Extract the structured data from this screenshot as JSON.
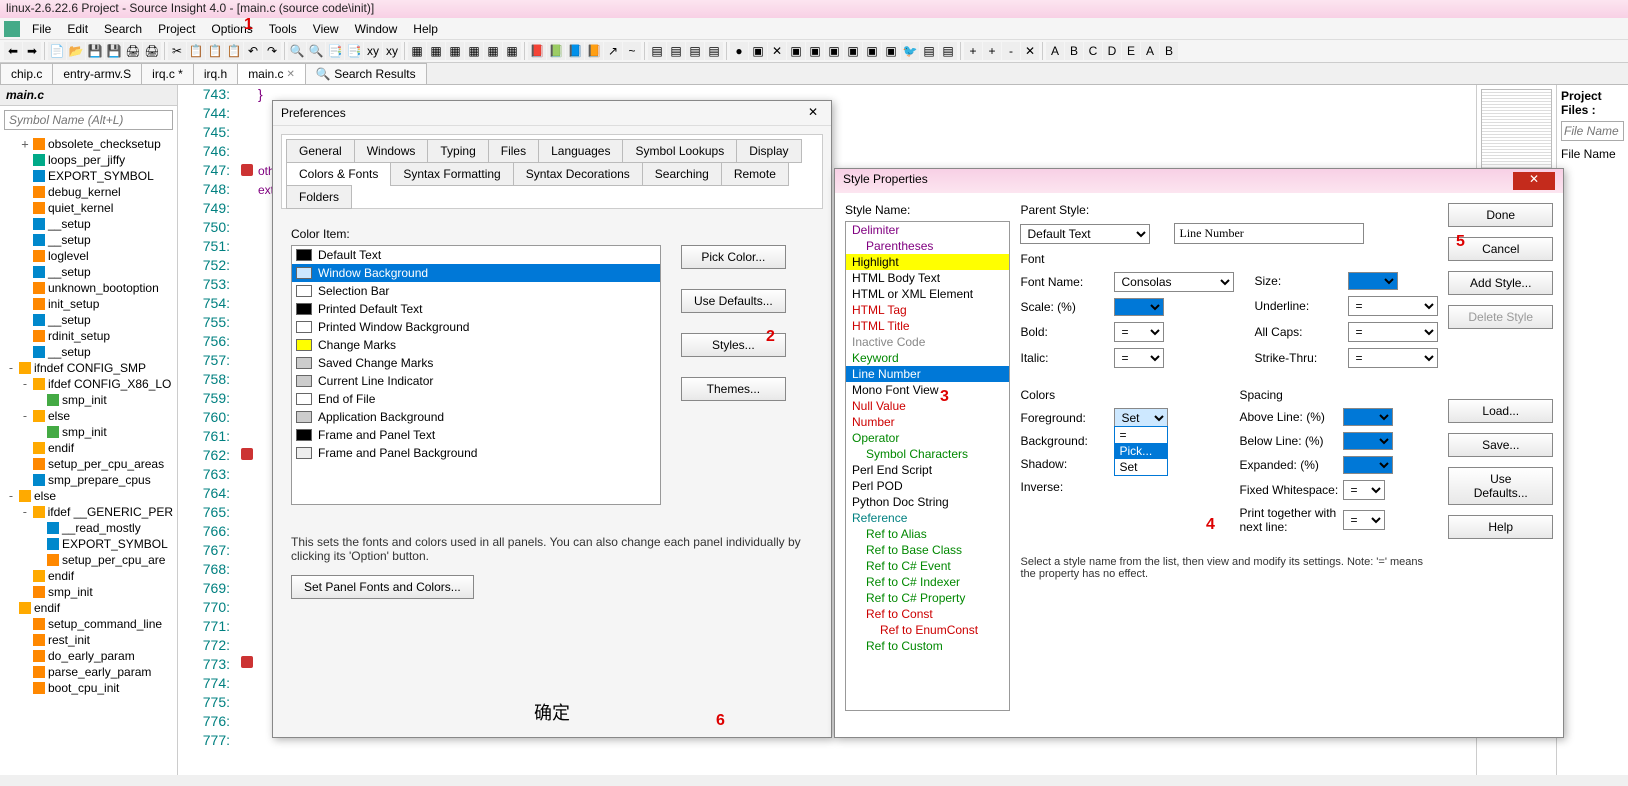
{
  "window_title": "linux-2.6.22.6 Project - Source Insight 4.0 - [main.c (source code\\init)]",
  "menu": [
    "File",
    "Edit",
    "Search",
    "Project",
    "Options",
    "Tools",
    "View",
    "Window",
    "Help"
  ],
  "tabs": [
    {
      "label": "chip.c",
      "active": false
    },
    {
      "label": "entry-armv.S",
      "active": false
    },
    {
      "label": "irq.c *",
      "active": false,
      "mod": true
    },
    {
      "label": "irq.h",
      "active": false
    },
    {
      "label": "main.c",
      "active": true,
      "close": true
    },
    {
      "label": "Search Results",
      "active": false,
      "icon": true
    }
  ],
  "left": {
    "title": "main.c",
    "placeholder": "Symbol Name (Alt+L)",
    "items": [
      {
        "t": "obsolete_checksetup",
        "i": "#f80",
        "ind": 1,
        "exp": "+"
      },
      {
        "t": "loops_per_jiffy",
        "i": "#0a8",
        "ind": 1
      },
      {
        "t": "EXPORT_SYMBOL",
        "i": "#08c",
        "ind": 1
      },
      {
        "t": "debug_kernel",
        "i": "#f80",
        "ind": 1
      },
      {
        "t": "quiet_kernel",
        "i": "#f80",
        "ind": 1
      },
      {
        "t": "__setup",
        "i": "#08c",
        "ind": 1
      },
      {
        "t": "__setup",
        "i": "#08c",
        "ind": 1
      },
      {
        "t": "loglevel",
        "i": "#f80",
        "ind": 1
      },
      {
        "t": "__setup",
        "i": "#08c",
        "ind": 1
      },
      {
        "t": "unknown_bootoption",
        "i": "#f80",
        "ind": 1
      },
      {
        "t": "init_setup",
        "i": "#f80",
        "ind": 1
      },
      {
        "t": "__setup",
        "i": "#08c",
        "ind": 1
      },
      {
        "t": "rdinit_setup",
        "i": "#f80",
        "ind": 1
      },
      {
        "t": "__setup",
        "i": "#08c",
        "ind": 1
      },
      {
        "t": "ifndef CONFIG_SMP",
        "i": "#fa0",
        "ind": 0,
        "exp": "-"
      },
      {
        "t": "ifdef CONFIG_X86_LO",
        "i": "#fa0",
        "ind": 1,
        "exp": "-"
      },
      {
        "t": "smp_init",
        "i": "#4a4",
        "ind": 2
      },
      {
        "t": "else",
        "i": "#fa0",
        "ind": 1,
        "exp": "-"
      },
      {
        "t": "smp_init",
        "i": "#4a4",
        "ind": 2
      },
      {
        "t": "endif",
        "i": "#fa0",
        "ind": 1
      },
      {
        "t": "setup_per_cpu_areas",
        "i": "#f80",
        "ind": 1
      },
      {
        "t": "smp_prepare_cpus",
        "i": "#08c",
        "ind": 1
      },
      {
        "t": "else",
        "i": "#fa0",
        "ind": 0,
        "exp": "-"
      },
      {
        "t": "ifdef __GENERIC_PER",
        "i": "#fa0",
        "ind": 1,
        "exp": "-"
      },
      {
        "t": "__read_mostly",
        "i": "#08c",
        "ind": 2
      },
      {
        "t": "EXPORT_SYMBOL",
        "i": "#08c",
        "ind": 2
      },
      {
        "t": "setup_per_cpu_are",
        "i": "#f80",
        "ind": 2
      },
      {
        "t": "endif",
        "i": "#fa0",
        "ind": 1
      },
      {
        "t": "smp_init",
        "i": "#f80",
        "ind": 1
      },
      {
        "t": "endif",
        "i": "#fa0",
        "ind": 0
      },
      {
        "t": "setup_command_line",
        "i": "#f80",
        "ind": 1
      },
      {
        "t": "rest_init",
        "i": "#f80",
        "ind": 1
      },
      {
        "t": "do_early_param",
        "i": "#f80",
        "ind": 1
      },
      {
        "t": "parse_early_param",
        "i": "#f80",
        "ind": 1
      },
      {
        "t": "boot_cpu_init",
        "i": "#f80",
        "ind": 1
      }
    ]
  },
  "gutter_start": 743,
  "gutter_count": 35,
  "code_snippets": [
    "otherwise gcc",
    "ext section"
  ],
  "right": {
    "title": "Project Files :",
    "ph": "File Name (Ct",
    "lbl": "File Name"
  },
  "prefs": {
    "title": "Preferences",
    "tab_row1": [
      "General",
      "Windows",
      "Typing",
      "Files",
      "Languages",
      "Symbol Lookups",
      "Display"
    ],
    "tab_row2": [
      "Colors & Fonts",
      "Syntax Formatting",
      "Syntax Decorations",
      "Searching",
      "Remote",
      "Folders"
    ],
    "active_tab": "Colors & Fonts",
    "label": "Color Item:",
    "items": [
      {
        "n": "Default Text",
        "c": "#000"
      },
      {
        "n": "Window Background",
        "c": "#cde8ff",
        "sel": true
      },
      {
        "n": "Selection Bar",
        "c": "#fff"
      },
      {
        "n": "Printed Default Text",
        "c": "#000"
      },
      {
        "n": "Printed Window Background",
        "c": "#fff"
      },
      {
        "n": "Change Marks",
        "c": "#ff0"
      },
      {
        "n": "Saved Change Marks",
        "c": "#ccc"
      },
      {
        "n": "Current Line Indicator",
        "c": "#ccc"
      },
      {
        "n": "End of File",
        "c": "#fff"
      },
      {
        "n": "Application Background",
        "c": "#ccc"
      },
      {
        "n": "Frame and Panel Text",
        "c": "#000"
      },
      {
        "n": "Frame and Panel Background",
        "c": "#eee"
      }
    ],
    "btns": [
      "Pick Color...",
      "Use Defaults...",
      "Styles...",
      "Themes..."
    ],
    "desc": "This sets the fonts and colors used in all panels. You can also change each panel individually by clicking its 'Option' button.",
    "panel_btn": "Set Panel Fonts and Colors...",
    "ok": "确定"
  },
  "sp": {
    "title": "Style Properties",
    "style_name_label": "Style Name:",
    "parent_label": "Parent Style:",
    "parent_value": "Default Text",
    "name_value": "Line Number",
    "styles": [
      {
        "n": "Delimiter",
        "c": "#800080"
      },
      {
        "n": "Parentheses",
        "c": "#800080",
        "ind": 1
      },
      {
        "n": "Highlight",
        "c": "#000",
        "bg": "#ffff00"
      },
      {
        "n": "HTML Body Text",
        "c": "#000"
      },
      {
        "n": "HTML or XML Element",
        "c": "#000"
      },
      {
        "n": "HTML Tag",
        "c": "#c00"
      },
      {
        "n": "HTML Title",
        "c": "#c00"
      },
      {
        "n": "Inactive Code",
        "c": "#888"
      },
      {
        "n": "Keyword",
        "c": "#080"
      },
      {
        "n": "Line Number",
        "c": "#000",
        "sel": true
      },
      {
        "n": "Mono Font View",
        "c": "#000"
      },
      {
        "n": "Null Value",
        "c": "#c00"
      },
      {
        "n": "Number",
        "c": "#c00"
      },
      {
        "n": "Operator",
        "c": "#080"
      },
      {
        "n": "Symbol Characters",
        "c": "#080",
        "ind": 1
      },
      {
        "n": "Perl End Script",
        "c": "#000"
      },
      {
        "n": "Perl POD",
        "c": "#000"
      },
      {
        "n": "Python Doc String",
        "c": "#000"
      },
      {
        "n": "Reference",
        "c": "#008080"
      },
      {
        "n": "Ref to Alias",
        "c": "#080",
        "ind": 1
      },
      {
        "n": "Ref to Base Class",
        "c": "#080",
        "ind": 1
      },
      {
        "n": "Ref to C# Event",
        "c": "#080",
        "ind": 1
      },
      {
        "n": "Ref to C# Indexer",
        "c": "#080",
        "ind": 1
      },
      {
        "n": "Ref to C# Property",
        "c": "#080",
        "ind": 1
      },
      {
        "n": "Ref to Const",
        "c": "#c00",
        "ind": 1
      },
      {
        "n": "Ref to EnumConst",
        "c": "#c00",
        "ind": 2
      },
      {
        "n": "Ref to Custom",
        "c": "#080",
        "ind": 1
      }
    ],
    "font_label": "Font",
    "font_name_label": "Font Name:",
    "font_name": "Consolas",
    "size_label": "Size:",
    "scale_label": "Scale: (%)",
    "underline_label": "Underline:",
    "bold_label": "Bold:",
    "allcaps_label": "All Caps:",
    "italic_label": "Italic:",
    "strike_label": "Strike-Thru:",
    "eq": "=",
    "colors_label": "Colors",
    "fg_label": "Foreground:",
    "bg_label": "Background:",
    "shadow_label": "Shadow:",
    "inverse_label": "Inverse:",
    "set": "Set",
    "dd_opts": [
      "=",
      "Pick...",
      "Set"
    ],
    "spacing_label": "Spacing",
    "above_label": "Above Line: (%)",
    "below_label": "Below Line: (%)",
    "expanded_label": "Expanded: (%)",
    "fixed_label": "Fixed Whitespace:",
    "print_label": "Print together with next line:",
    "btns": [
      "Done",
      "Cancel",
      "Add Style...",
      "Delete Style",
      "Load...",
      "Save...",
      "Use Defaults...",
      "Help"
    ],
    "note": "Select a style name from the list, then view and modify its settings. Note: '=' means the property has no effect."
  },
  "annotations": {
    "1": "1",
    "2": "2",
    "3": "3",
    "4": "4",
    "5": "5",
    "6": "6"
  }
}
